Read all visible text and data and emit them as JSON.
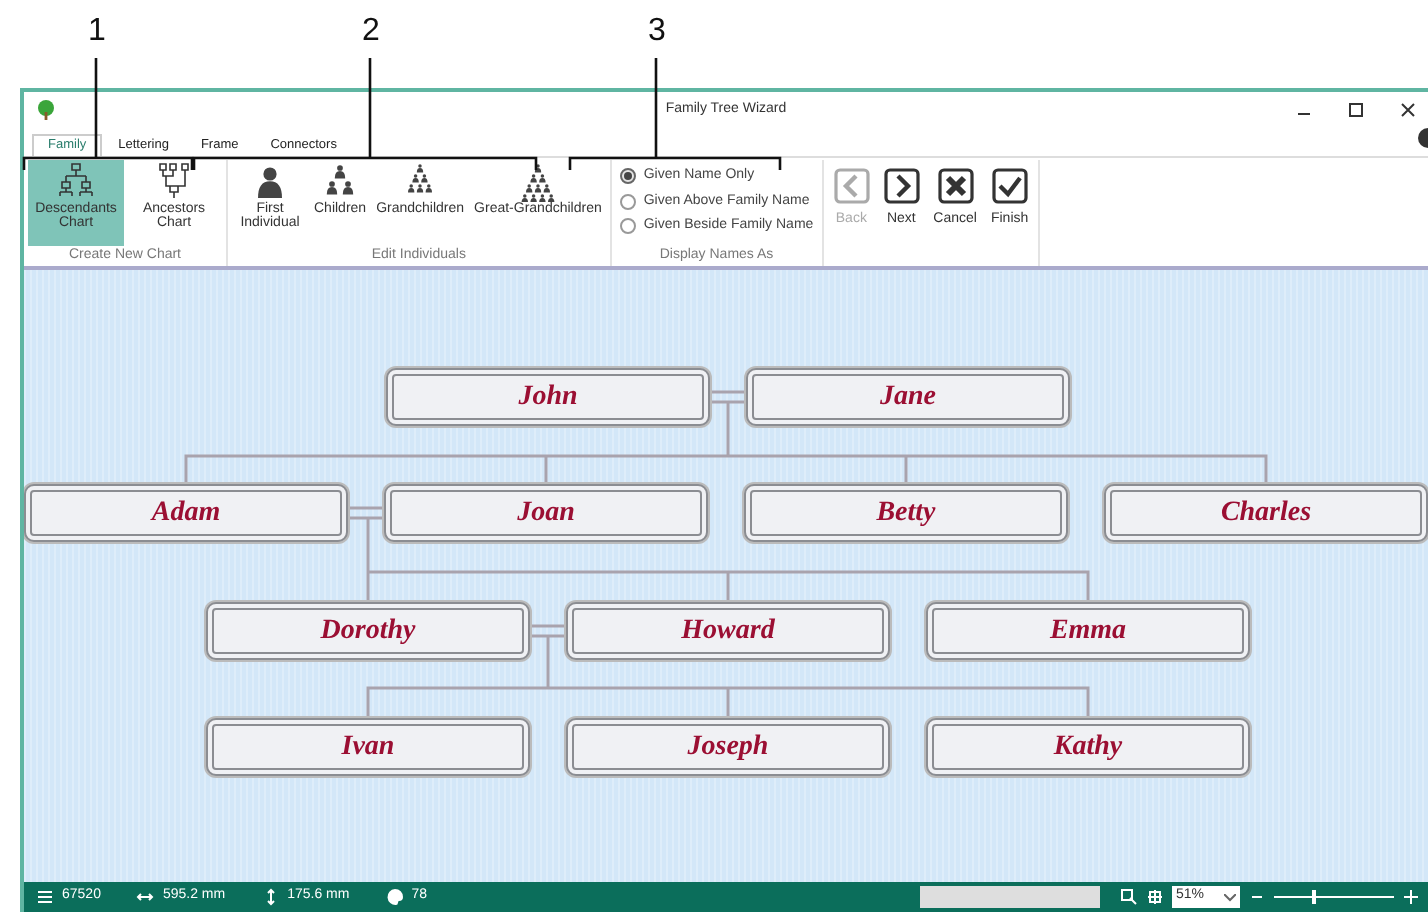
{
  "callouts": [
    "1",
    "2",
    "3"
  ],
  "window": {
    "title": "Family Tree Wizard"
  },
  "tabs": [
    {
      "label": "Family",
      "selected": true
    },
    {
      "label": "Lettering",
      "selected": false
    },
    {
      "label": "Frame",
      "selected": false
    },
    {
      "label": "Connectors",
      "selected": false
    }
  ],
  "ribbon": [
    {
      "kind": "buttons",
      "label": "Create New Chart",
      "items": [
        {
          "label": "Descendants Chart",
          "kind": "descendants",
          "selected": true
        },
        {
          "label": "Ancestors Chart",
          "kind": "ancestors",
          "selected": false
        }
      ]
    },
    {
      "kind": "actions",
      "label": "Edit Individuals",
      "items": [
        {
          "label": "First Individual",
          "kind": "person"
        },
        {
          "label": "Children",
          "kind": "children"
        },
        {
          "label": "Grandchildren",
          "kind": "grandchildren"
        },
        {
          "label": "Great-Grandchildren",
          "kind": "great-grandchildren"
        }
      ]
    },
    {
      "kind": "radios",
      "label": "Display Names As",
      "items": [
        {
          "label": "Given Name Only",
          "selected": true
        },
        {
          "label": "Given Above Family Name",
          "selected": false
        },
        {
          "label": "Given Beside Family Name",
          "selected": false
        }
      ]
    },
    {
      "kind": "nav",
      "items": [
        {
          "label": "Back",
          "kind": "back",
          "disabled": true
        },
        {
          "label": "Next",
          "kind": "next",
          "disabled": false
        },
        {
          "label": "Cancel",
          "kind": "cancel",
          "disabled": false
        },
        {
          "label": "Finish",
          "kind": "finish",
          "disabled": false
        }
      ]
    }
  ],
  "tree": {
    "generations": [
      [
        "John",
        "Jane"
      ],
      [
        "Adam",
        "Joan",
        "Betty",
        "Charles"
      ],
      [
        "Dorothy",
        "Howard",
        "Emma"
      ],
      [
        "Ivan",
        "Joseph",
        "Kathy"
      ]
    ]
  },
  "status_bar": {
    "stitches": "67520",
    "width": "595.2 mm",
    "height": "175.6 mm",
    "colors": "78",
    "zoom": "51%",
    "zoom_slider": {
      "level": 0.33
    }
  }
}
